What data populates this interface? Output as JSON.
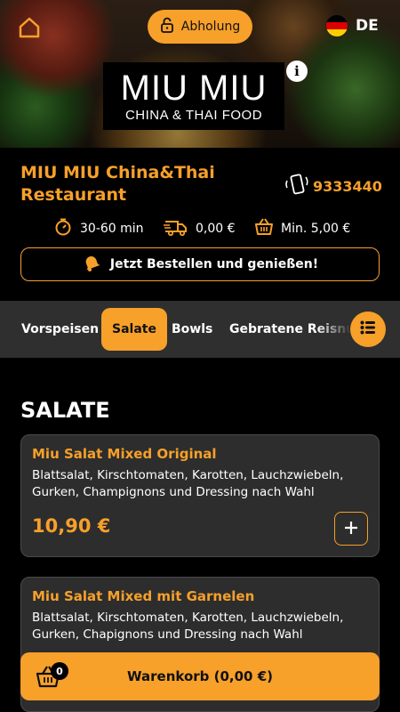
{
  "header": {
    "pickup_label": "Abholung",
    "language_code": "DE",
    "logo_main": "MIU MIU",
    "logo_sub": "CHINA & THAI FOOD"
  },
  "restaurant": {
    "name": "MIU MIU China&Thai Restaurant",
    "phone": "9333440",
    "delivery_time": "30-60 min",
    "delivery_fee": "0,00 €",
    "min_order": "Min. 5,00 €",
    "order_cta": "Jetzt Bestellen und genießen!"
  },
  "categories": {
    "items": [
      {
        "label": "Vorspeisen"
      },
      {
        "label": "Salate"
      },
      {
        "label": "Bowls"
      },
      {
        "label": "Gebratene Reisnu"
      }
    ],
    "active": "Salate"
  },
  "section": {
    "title": "SALATE"
  },
  "products": [
    {
      "name": "Miu Salat Mixed Original",
      "description": "Blattsalat, Kirschtomaten, Karotten, Lauchzwiebeln, Gurken, Champignons und Dressing nach Wahl",
      "price": "10,90 €"
    },
    {
      "name": "Miu Salat Mixed mit Garnelen",
      "description": "Blattsalat, Kirschtomaten, Karotten, Lauchzwiebeln, Gurken, Chapignons und Dressing nach Wahl",
      "price": ""
    }
  ],
  "cart": {
    "count": "0",
    "label": "Warenkorb (0,00 €)"
  },
  "colors": {
    "accent": "#f7a02a",
    "background": "#000000",
    "card": "#2d2d2d",
    "category_bar": "#2f2f2f"
  },
  "icons": [
    "home-icon",
    "lock-icon",
    "flag-de-icon",
    "info-icon",
    "phone-icon",
    "timer-icon",
    "delivery-truck-icon",
    "basket-icon",
    "bell-icon",
    "list-icon",
    "plus-icon",
    "cart-icon"
  ]
}
